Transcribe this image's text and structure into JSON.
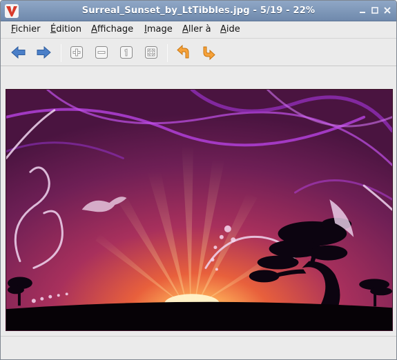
{
  "window": {
    "title": "Surreal_Sunset_by_LtTibbles.jpg - 5/19 - 22%"
  },
  "menubar": {
    "items": [
      {
        "first": "F",
        "rest": "ichier"
      },
      {
        "first": "É",
        "rest": "dition"
      },
      {
        "first": "A",
        "rest": "ffichage"
      },
      {
        "first": "I",
        "rest": "mage"
      },
      {
        "first": "A",
        "rest": "ller à"
      },
      {
        "first": "A",
        "rest": "ide"
      }
    ]
  },
  "toolbar": {
    "icons": [
      "arrow-left-icon",
      "arrow-right-icon",
      "zoom-in-icon",
      "zoom-out-icon",
      "zoom-normal-icon",
      "zoom-fit-icon",
      "rotate-left-icon",
      "rotate-right-icon"
    ]
  },
  "colors": {
    "titlebar": "#7d95b8",
    "arrows": "#4a7fc8",
    "rotate": "#f0961c",
    "sky_top": "#5a1a4a",
    "sun": "#fff6c0"
  },
  "image": {
    "subject": "surreal-sunset-wallpaper"
  }
}
